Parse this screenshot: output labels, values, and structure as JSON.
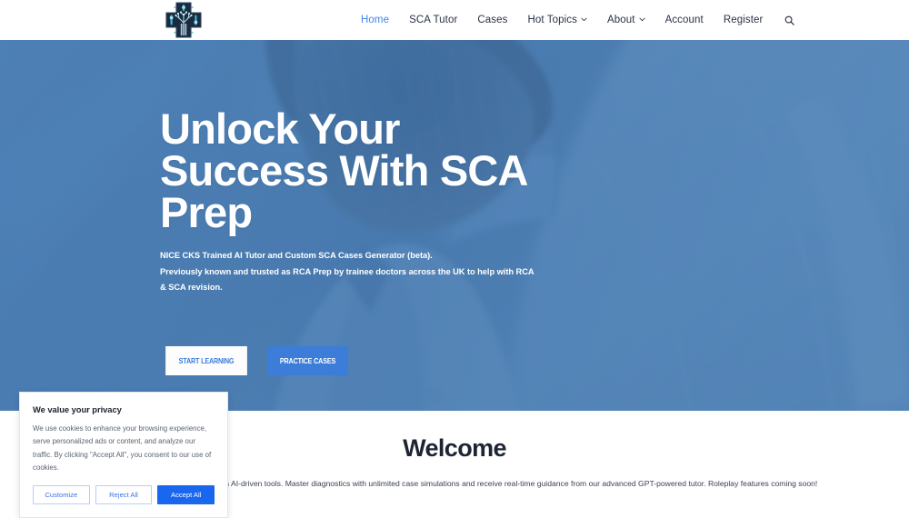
{
  "site": {
    "logo_alt": "SCA Prep logo",
    "accent_blue": "#3b7dd8",
    "nav_active_color": "#4285e8",
    "hero_overlay": "#5c86b3",
    "heading_color": "#1e2433",
    "cookie_accent": "#1967ef"
  },
  "nav": {
    "items": [
      {
        "label": "Home",
        "has_caret": false,
        "active": true
      },
      {
        "label": "SCA Tutor",
        "has_caret": false,
        "active": false
      },
      {
        "label": "Cases",
        "has_caret": false,
        "active": false
      },
      {
        "label": "Hot Topics",
        "has_caret": true,
        "active": false
      },
      {
        "label": "About",
        "has_caret": true,
        "active": false
      },
      {
        "label": "Account",
        "has_caret": false,
        "active": false
      },
      {
        "label": "Register",
        "has_caret": false,
        "active": false
      }
    ],
    "search_icon": "search-icon"
  },
  "hero": {
    "title": "Unlock Your Success With SCA Prep",
    "subtitle_line1": "NICE CKS Trained AI Tutor and Custom SCA Cases Generator (beta).",
    "subtitle_line2": "Previously known and trusted as RCA Prep by trainee doctors across the UK to help with RCA & SCA revision.",
    "primary_cta": "START LEARNING",
    "secondary_cta": "PRACTICE CASES"
  },
  "welcome": {
    "title": "Welcome",
    "body": "Supercharge your SCA preparation with AI-driven tools. Master diagnostics with unlimited case simulations and receive real-time guidance from our advanced GPT-powered tutor. Roleplay features coming soon!"
  },
  "cookie": {
    "title": "We value your privacy",
    "body": "We use cookies to enhance your browsing experience, serve personalized ads or content, and analyze our traffic. By clicking \"Accept All\", you consent to our use of cookies.",
    "customize_label": "Customize",
    "reject_label": "Reject All",
    "accept_label": "Accept All"
  }
}
